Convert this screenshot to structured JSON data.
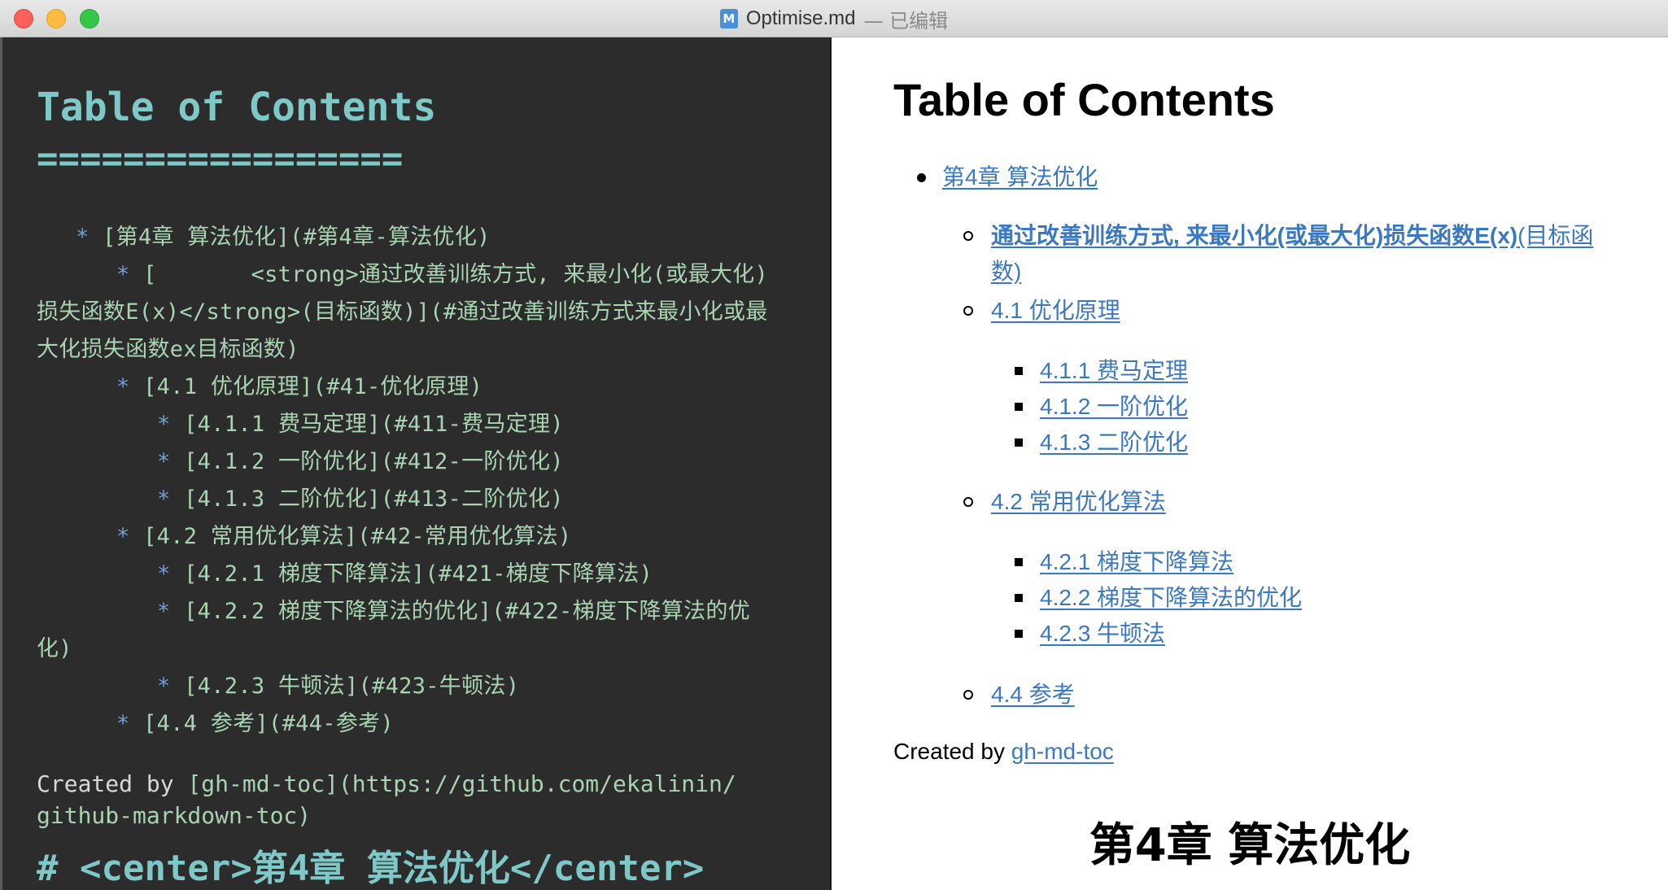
{
  "window": {
    "filename": "Optimise.md",
    "status": "— 已编辑",
    "file_icon_glyph": "M"
  },
  "editor": {
    "heading": "Table of Contents",
    "heading_underline": "=================",
    "lines": [
      {
        "bullet": "*",
        "text": " [第4章 算法优化](#第4章-算法优化)"
      },
      {
        "bullet": "*",
        "text": " [       <strong>通过改善训练方式, 来最小化(或最大化)"
      },
      {
        "bullet": "",
        "text": "损失函数E(x)</strong>(目标函数)](#通过改善训练方式来最小化或最"
      },
      {
        "bullet": "",
        "text": "大化损失函数ex目标函数)"
      },
      {
        "bullet": "*",
        "text": " [4.1 优化原理](#41-优化原理)"
      },
      {
        "bullet": "*",
        "text": " [4.1.1 费马定理](#411-费马定理)"
      },
      {
        "bullet": "*",
        "text": " [4.1.2 一阶优化](#412-一阶优化)"
      },
      {
        "bullet": "*",
        "text": " [4.1.3 二阶优化](#413-二阶优化)"
      },
      {
        "bullet": "*",
        "text": " [4.2 常用优化算法](#42-常用优化算法)"
      },
      {
        "bullet": "*",
        "text": " [4.2.1 梯度下降算法](#421-梯度下降算法)"
      },
      {
        "bullet": "*",
        "text": " [4.2.2 梯度下降算法的优化](#422-梯度下降算法的优"
      },
      {
        "bullet": "",
        "text": "化)"
      },
      {
        "bullet": "*",
        "text": " [4.2.3 牛顿法](#423-牛顿法)"
      },
      {
        "bullet": "*",
        "text": " [4.4 参考](#44-参考)"
      }
    ],
    "created_prefix": "Created by ",
    "created_link_line1": "[gh-md-toc](https://github.com/ekalinin/",
    "created_link_line2": "github-markdown-toc)",
    "h1_line": "# <center>第4章 算法优化</center>"
  },
  "preview": {
    "title": "Table of Contents",
    "items": [
      {
        "level": 1,
        "label": "第4章 算法优化"
      },
      {
        "level": 2,
        "label_strong": "       通过改善训练方式, 来最小化(或最大化)损失函数E(x)",
        "label_rest": "(目标函数)"
      },
      {
        "level": 2,
        "label": "4.1 优化原理"
      },
      {
        "level": 3,
        "label": "4.1.1 费马定理"
      },
      {
        "level": 3,
        "label": "4.1.2 一阶优化"
      },
      {
        "level": 3,
        "label": "4.1.3 二阶优化"
      },
      {
        "level": 2,
        "label": "4.2 常用优化算法"
      },
      {
        "level": 3,
        "label": "4.2.1 梯度下降算法"
      },
      {
        "level": 3,
        "label": "4.2.2 梯度下降算法的优化"
      },
      {
        "level": 3,
        "label": "4.2.3 牛顿法"
      },
      {
        "level": 2,
        "label": "4.4 参考"
      }
    ],
    "created_prefix": "Created by ",
    "created_link": "gh-md-toc",
    "h1": "第4章 算法优化"
  },
  "colors": {
    "editor_bg": "#2c2c2c",
    "editor_heading": "#7fc8c8",
    "editor_text": "#a9d4b2",
    "editor_bullet": "#6ea0d8",
    "link": "#3b78c2"
  }
}
